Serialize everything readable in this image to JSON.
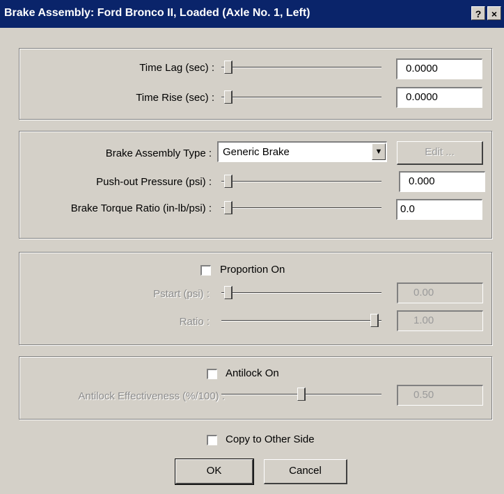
{
  "window": {
    "title": "Brake Assembly: Ford  Bronco II, Loaded  (Axle No. 1, Left)",
    "help_glyph": "?",
    "close_glyph": "×"
  },
  "timing": {
    "time_lag_label": "Time Lag (sec) :",
    "time_lag_value": "0.0000",
    "time_lag_level": 0.0,
    "time_rise_label": "Time Rise (sec) :",
    "time_rise_value": "0.0000",
    "time_rise_level": 0.0
  },
  "brake": {
    "type_label": "Brake Assembly Type :",
    "type_value": "Generic Brake",
    "edit_label": "Edit ...",
    "pushout_label": "Push-out Pressure (psi) :",
    "pushout_value": "0.000",
    "pushout_level": 0.0,
    "torque_label": "Brake Torque Ratio (in-lb/psi) :",
    "torque_value": "0.0",
    "torque_level": 0.0
  },
  "proportion": {
    "checkbox_label": "Proportion On",
    "checked": false,
    "pstart_label": "Pstart (psi) :",
    "pstart_value": "0.00",
    "pstart_level": 0.0,
    "ratio_label": "Ratio :",
    "ratio_value": "1.00",
    "ratio_level": 1.0
  },
  "antilock": {
    "checkbox_label": "Antilock On",
    "checked": false,
    "effectiveness_label": "Antilock Effectiveness (%/100) :",
    "effectiveness_value": "0.50",
    "effectiveness_level": 0.5
  },
  "footer": {
    "copy_label": "Copy to Other Side",
    "copy_checked": false,
    "ok_label": "OK",
    "cancel_label": "Cancel"
  }
}
